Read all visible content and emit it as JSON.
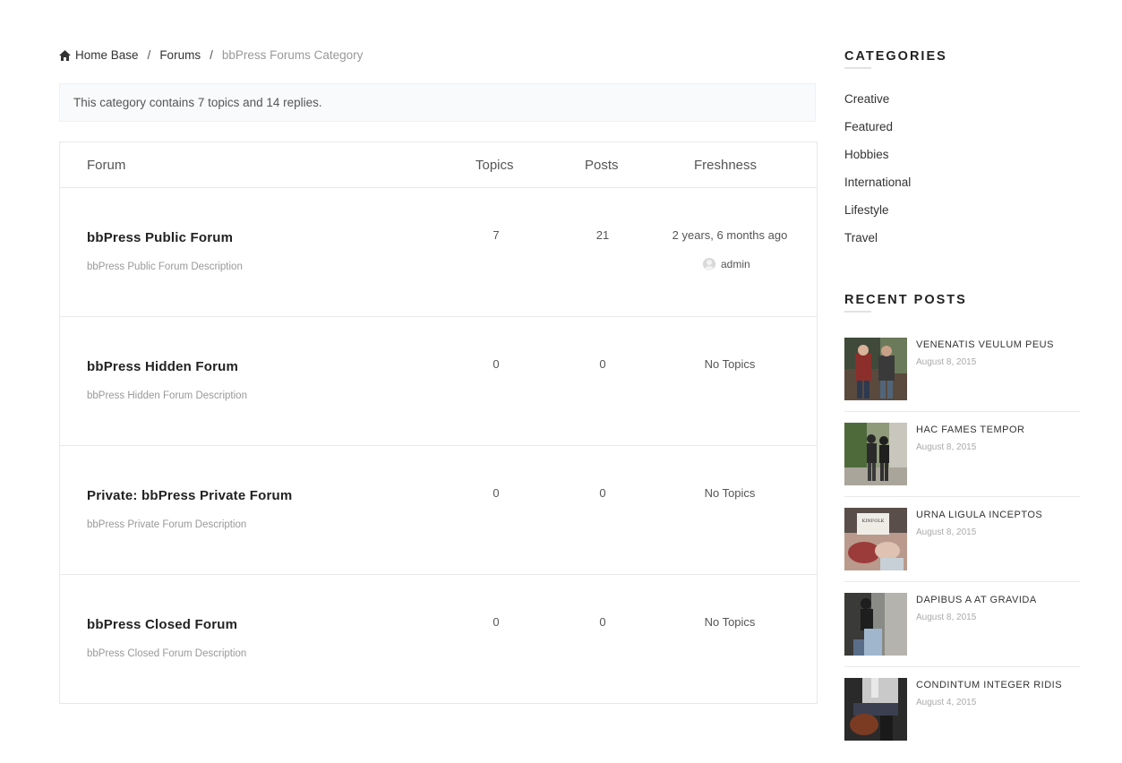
{
  "breadcrumb": {
    "home": "Home Base",
    "sep1": "/",
    "forums": "Forums",
    "sep2": "/",
    "current": "bbPress Forums Category"
  },
  "notice": "This category contains 7 topics and 14 replies.",
  "table": {
    "headers": {
      "forum": "Forum",
      "topics": "Topics",
      "posts": "Posts",
      "freshness": "Freshness"
    },
    "rows": [
      {
        "title": "bbPress Public Forum",
        "description": "bbPress Public Forum Description",
        "topics": "7",
        "posts": "21",
        "freshness": "2 years, 6 months ago",
        "author": "admin"
      },
      {
        "title": "bbPress Hidden Forum",
        "description": "bbPress Hidden Forum Description",
        "topics": "0",
        "posts": "0",
        "freshness": "No Topics",
        "author": ""
      },
      {
        "title": "Private: bbPress Private Forum",
        "description": "bbPress Private Forum Description",
        "topics": "0",
        "posts": "0",
        "freshness": "No Topics",
        "author": ""
      },
      {
        "title": "bbPress Closed Forum",
        "description": "bbPress Closed Forum Description",
        "topics": "0",
        "posts": "0",
        "freshness": "No Topics",
        "author": ""
      }
    ]
  },
  "sidebar": {
    "categories_title": "CATEGORIES",
    "categories": [
      "Creative",
      "Featured",
      "Hobbies",
      "International",
      "Lifestyle",
      "Travel"
    ],
    "recent_title": "RECENT POSTS",
    "recent": [
      {
        "title": "VENENATIS VEULUM PEUS",
        "date": "August 8, 2015"
      },
      {
        "title": "HAC FAMES TEMPOR",
        "date": "August 8, 2015"
      },
      {
        "title": "URNA LIGULA INCEPTOS",
        "date": "August 8, 2015"
      },
      {
        "title": "DAPIBUS A AT GRAVIDA",
        "date": "August 8, 2015"
      },
      {
        "title": "CONDINTUM INTEGER RIDIS",
        "date": "August 4, 2015"
      }
    ],
    "thumb_text": "KINFOLK"
  }
}
